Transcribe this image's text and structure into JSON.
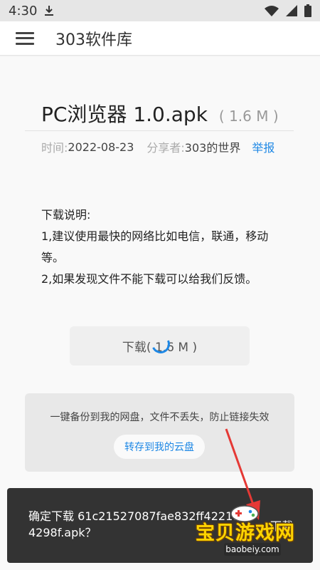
{
  "status_bar": {
    "time": "4:30"
  },
  "app_bar": {
    "title": "303软件库"
  },
  "file": {
    "name": "PC浏览器 1.0.apk",
    "size": "( 1.6 M )",
    "time_label": "时间:",
    "time_value": "2022-08-23",
    "sharer_label": "分享者:",
    "sharer_value": "303的世界",
    "report_label": "举报"
  },
  "description": {
    "heading": "下载说明:",
    "line1": "1,建议使用最快的网络比如电信，联通，移动等。",
    "line2": "2,如果发现文件不能下载可以给我们反馈。"
  },
  "download_button": {
    "label": "下载( 1.6 M )"
  },
  "backup": {
    "text": "一键备份到我的网盘，文件不丢失，防止链接失效",
    "button_label": "转存到我的云盘"
  },
  "snackbar": {
    "message": "确定下载 61c21527087fae832ff4221d84298f.apk？",
    "action": "下载"
  },
  "watermark": {
    "text_cn": "宝贝游戏网",
    "url": "baobeiy.com"
  },
  "colors": {
    "accent": "#1e88e5",
    "snackbar_bg": "#333333",
    "watermark": "#ffd400",
    "arrow": "#e53935"
  }
}
